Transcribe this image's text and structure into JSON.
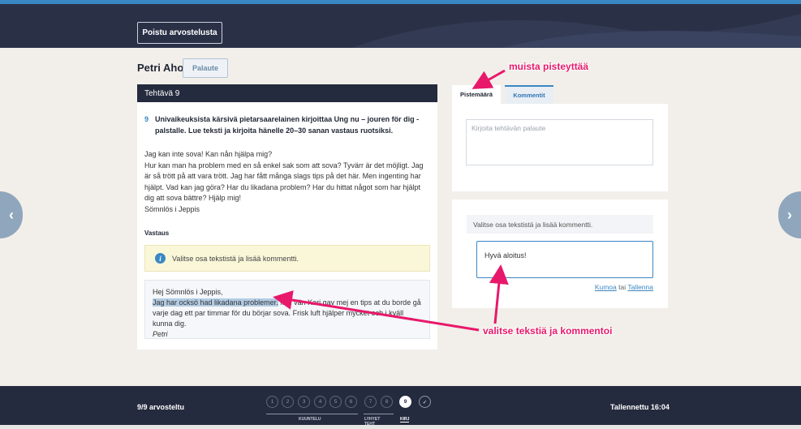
{
  "header": {
    "exit_label": "Poistu arvostelusta"
  },
  "student": {
    "name": "Petri Aho",
    "feedback_button": "Palaute"
  },
  "task": {
    "header": "Tehtävä 9",
    "number": "9",
    "question": "Univaikeuksista kärsivä pietarsaarelainen kirjoittaa Ung nu – jouren för dig -palstalle. Lue teksti ja kirjoita hänelle 20–30 sanan vastaus ruotsiksi.",
    "letter": [
      "Jag kan inte sova! Kan nån hjälpa mig?",
      "Hur kan man ha problem med en så enkel sak som att sova? Tyvärr är det möjligt. Jag är så trött på att vara trött. Jag har fått många slags tips på det här. Men ingenting har hjälpt. Vad kan jag göra? Har du likadana problem? Har du hittat något som har hjälpt dig att sova bättre? Hjälp mig!",
      "Sömnlös i Jeppis"
    ],
    "answer_label": "Vastaus",
    "info_text": "Valitse osa tekstistä ja lisää kommentti.",
    "answer": {
      "greeting": "Hej Sömnlös i Jeppis,",
      "highlighted": "Jag har ocksö had likadana problemer.",
      "rest": " Min vän Kari gav mej en tips at du borde gå varje dag ett par timmar för du börjar sova. Frisk luft hjälper mycket och i kväll kunna dig.",
      "signature": "Petri"
    }
  },
  "tabs": {
    "points": "Pistemäärä",
    "comments": "Kommentit"
  },
  "feedback": {
    "placeholder": "Kirjoita tehtävän palaute"
  },
  "comment": {
    "hint": "Valitse osa tekstistä ja lisää kommentti.",
    "input_value": "Hyvä aloitus!",
    "cancel": "Kumoa",
    "or": "tai",
    "save": "Tallenna"
  },
  "annotations": {
    "top": "muista pisteyttää",
    "bottom": "valitse tekstiä ja kommentoi"
  },
  "footer": {
    "progress": "9/9 arvosteltu",
    "saved": "Tallennettu 16:04",
    "steps": [
      "1",
      "2",
      "3",
      "4",
      "5",
      "6",
      "7",
      "8",
      "9"
    ],
    "check": "✓",
    "groups": [
      "KUUNTELU",
      "LYHYET TEHT",
      "KIRJ"
    ]
  },
  "colors": {
    "accent": "#3b87c4",
    "annotation": "#e8186b",
    "dark": "#252b3e"
  }
}
